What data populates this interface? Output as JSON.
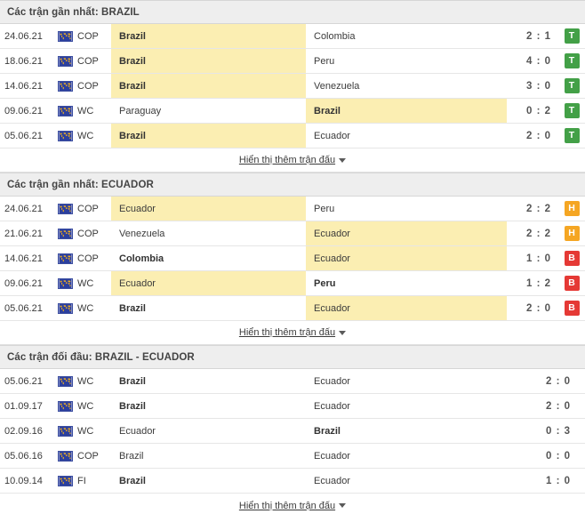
{
  "colors": {
    "win": "#43a047",
    "draw": "#f5a623",
    "loss": "#e53935",
    "highlight": "#fbeeb2",
    "header_band": "#eeeeee"
  },
  "sections": [
    {
      "title": "Các trận gần nhất: BRAZIL",
      "show_more": "Hiển thị thêm trận đấu",
      "has_badges": true,
      "rows": [
        {
          "date": "24.06.21",
          "flag": "world-icon",
          "competition": "COP",
          "home": "Brazil",
          "away": "Colombia",
          "score": "2 : 1",
          "home_bold": true,
          "away_bold": false,
          "home_highlight": true,
          "away_highlight": false,
          "badge": "T",
          "badge_type": "W"
        },
        {
          "date": "18.06.21",
          "flag": "world-icon",
          "competition": "COP",
          "home": "Brazil",
          "away": "Peru",
          "score": "4 : 0",
          "home_bold": true,
          "away_bold": false,
          "home_highlight": true,
          "away_highlight": false,
          "badge": "T",
          "badge_type": "W"
        },
        {
          "date": "14.06.21",
          "flag": "world-icon",
          "competition": "COP",
          "home": "Brazil",
          "away": "Venezuela",
          "score": "3 : 0",
          "home_bold": true,
          "away_bold": false,
          "home_highlight": true,
          "away_highlight": false,
          "badge": "T",
          "badge_type": "W"
        },
        {
          "date": "09.06.21",
          "flag": "world-icon",
          "competition": "WC",
          "home": "Paraguay",
          "away": "Brazil",
          "score": "0 : 2",
          "home_bold": false,
          "away_bold": true,
          "home_highlight": false,
          "away_highlight": true,
          "badge": "T",
          "badge_type": "W"
        },
        {
          "date": "05.06.21",
          "flag": "world-icon",
          "competition": "WC",
          "home": "Brazil",
          "away": "Ecuador",
          "score": "2 : 0",
          "home_bold": true,
          "away_bold": false,
          "home_highlight": true,
          "away_highlight": false,
          "badge": "T",
          "badge_type": "W"
        }
      ]
    },
    {
      "title": "Các trận gần nhất: ECUADOR",
      "show_more": "Hiển thị thêm trận đấu",
      "has_badges": true,
      "rows": [
        {
          "date": "24.06.21",
          "flag": "world-icon",
          "competition": "COP",
          "home": "Ecuador",
          "away": "Peru",
          "score": "2 : 2",
          "home_bold": false,
          "away_bold": false,
          "home_highlight": true,
          "away_highlight": false,
          "badge": "H",
          "badge_type": "D"
        },
        {
          "date": "21.06.21",
          "flag": "world-icon",
          "competition": "COP",
          "home": "Venezuela",
          "away": "Ecuador",
          "score": "2 : 2",
          "home_bold": false,
          "away_bold": false,
          "home_highlight": false,
          "away_highlight": true,
          "badge": "H",
          "badge_type": "D"
        },
        {
          "date": "14.06.21",
          "flag": "world-icon",
          "competition": "COP",
          "home": "Colombia",
          "away": "Ecuador",
          "score": "1 : 0",
          "home_bold": true,
          "away_bold": false,
          "home_highlight": false,
          "away_highlight": true,
          "badge": "B",
          "badge_type": "L"
        },
        {
          "date": "09.06.21",
          "flag": "world-icon",
          "competition": "WC",
          "home": "Ecuador",
          "away": "Peru",
          "score": "1 : 2",
          "home_bold": false,
          "away_bold": true,
          "home_highlight": true,
          "away_highlight": false,
          "badge": "B",
          "badge_type": "L"
        },
        {
          "date": "05.06.21",
          "flag": "world-icon",
          "competition": "WC",
          "home": "Brazil",
          "away": "Ecuador",
          "score": "2 : 0",
          "home_bold": true,
          "away_bold": false,
          "home_highlight": false,
          "away_highlight": true,
          "badge": "B",
          "badge_type": "L"
        }
      ]
    },
    {
      "title": "Các trận đối đầu: BRAZIL - ECUADOR",
      "show_more": "Hiển thị thêm trận đấu",
      "has_badges": false,
      "rows": [
        {
          "date": "05.06.21",
          "flag": "world-icon",
          "competition": "WC",
          "home": "Brazil",
          "away": "Ecuador",
          "score": "2 : 0",
          "home_bold": true,
          "away_bold": false,
          "home_highlight": false,
          "away_highlight": false,
          "badge": "",
          "badge_type": ""
        },
        {
          "date": "01.09.17",
          "flag": "world-icon",
          "competition": "WC",
          "home": "Brazil",
          "away": "Ecuador",
          "score": "2 : 0",
          "home_bold": true,
          "away_bold": false,
          "home_highlight": false,
          "away_highlight": false,
          "badge": "",
          "badge_type": ""
        },
        {
          "date": "02.09.16",
          "flag": "world-icon",
          "competition": "WC",
          "home": "Ecuador",
          "away": "Brazil",
          "score": "0 : 3",
          "home_bold": false,
          "away_bold": true,
          "home_highlight": false,
          "away_highlight": false,
          "badge": "",
          "badge_type": ""
        },
        {
          "date": "05.06.16",
          "flag": "world-icon",
          "competition": "COP",
          "home": "Brazil",
          "away": "Ecuador",
          "score": "0 : 0",
          "home_bold": false,
          "away_bold": false,
          "home_highlight": false,
          "away_highlight": false,
          "badge": "",
          "badge_type": ""
        },
        {
          "date": "10.09.14",
          "flag": "world-icon",
          "competition": "FI",
          "home": "Brazil",
          "away": "Ecuador",
          "score": "1 : 0",
          "home_bold": true,
          "away_bold": false,
          "home_highlight": false,
          "away_highlight": false,
          "badge": "",
          "badge_type": ""
        }
      ]
    }
  ]
}
